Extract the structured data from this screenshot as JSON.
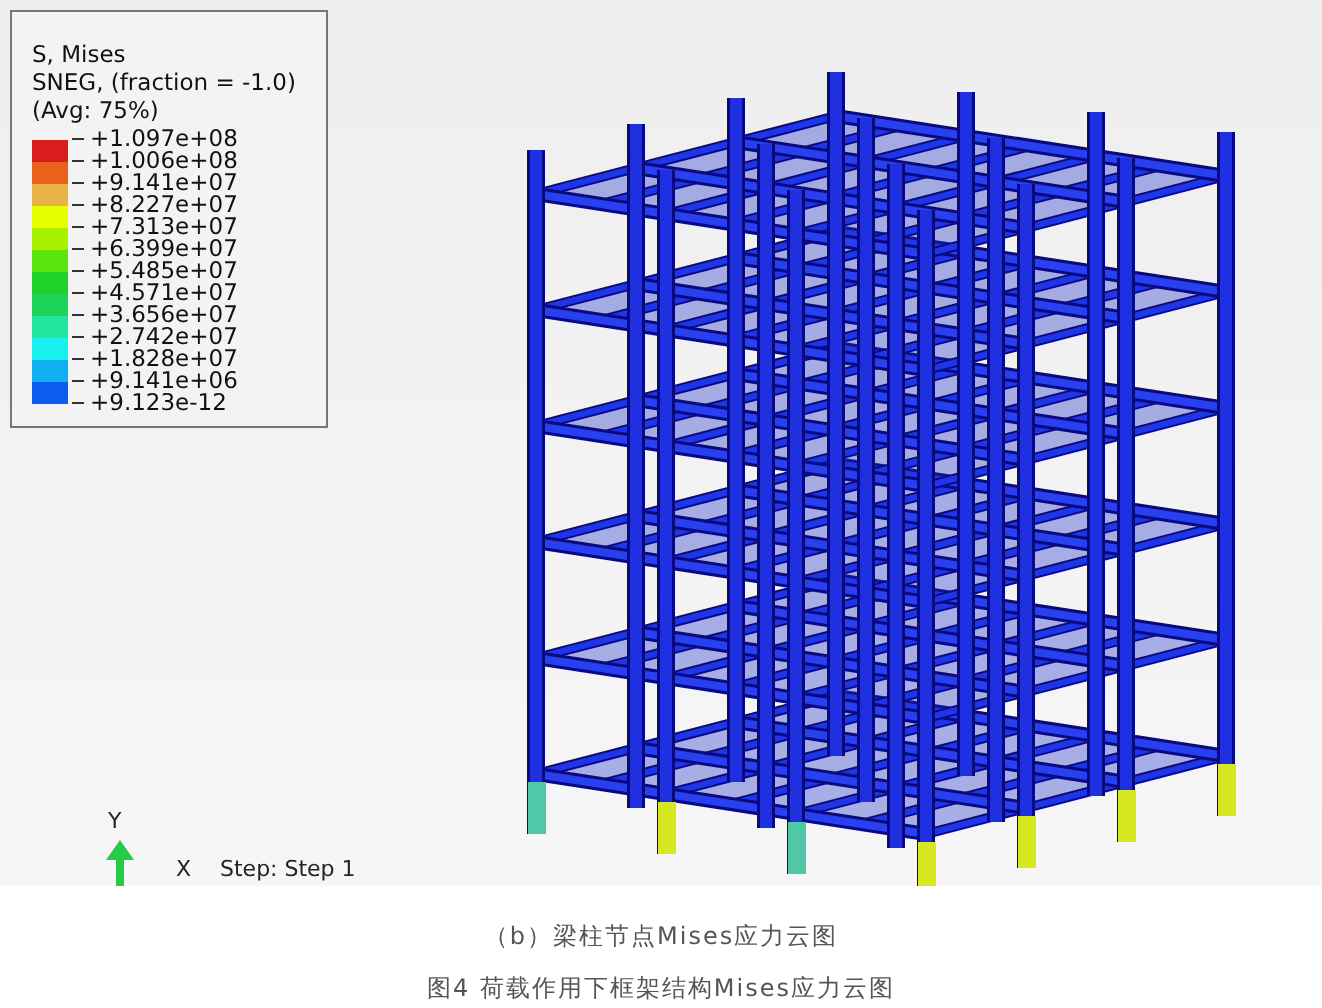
{
  "legend": {
    "title_lines": [
      "S, Mises",
      "SNEG, (fraction = -1.0)",
      "(Avg: 75%)"
    ],
    "bands": [
      {
        "color": "#d91c1c"
      },
      {
        "color": "#e8621e"
      },
      {
        "color": "#e8b246"
      },
      {
        "color": "#e6ff00"
      },
      {
        "color": "#a6f000"
      },
      {
        "color": "#5ae60c"
      },
      {
        "color": "#1ed22a"
      },
      {
        "color": "#1ed25a"
      },
      {
        "color": "#20e6a0"
      },
      {
        "color": "#18f0f0"
      },
      {
        "color": "#10b0f0"
      },
      {
        "color": "#0c5cf0"
      }
    ],
    "values": [
      "+1.097e+08",
      "+1.006e+08",
      "+9.141e+07",
      "+8.227e+07",
      "+7.313e+07",
      "+6.399e+07",
      "+5.485e+07",
      "+4.571e+07",
      "+3.656e+07",
      "+2.742e+07",
      "+1.828e+07",
      "+9.141e+06",
      "+9.123e-12"
    ]
  },
  "triad": {
    "y_label": "Y",
    "x_label": "X"
  },
  "step_label": "Step: Step 1",
  "captions": [
    "（b）梁柱节点Mises应力云图",
    "图4 荷载作用下框架结构Mises应力云图"
  ]
}
